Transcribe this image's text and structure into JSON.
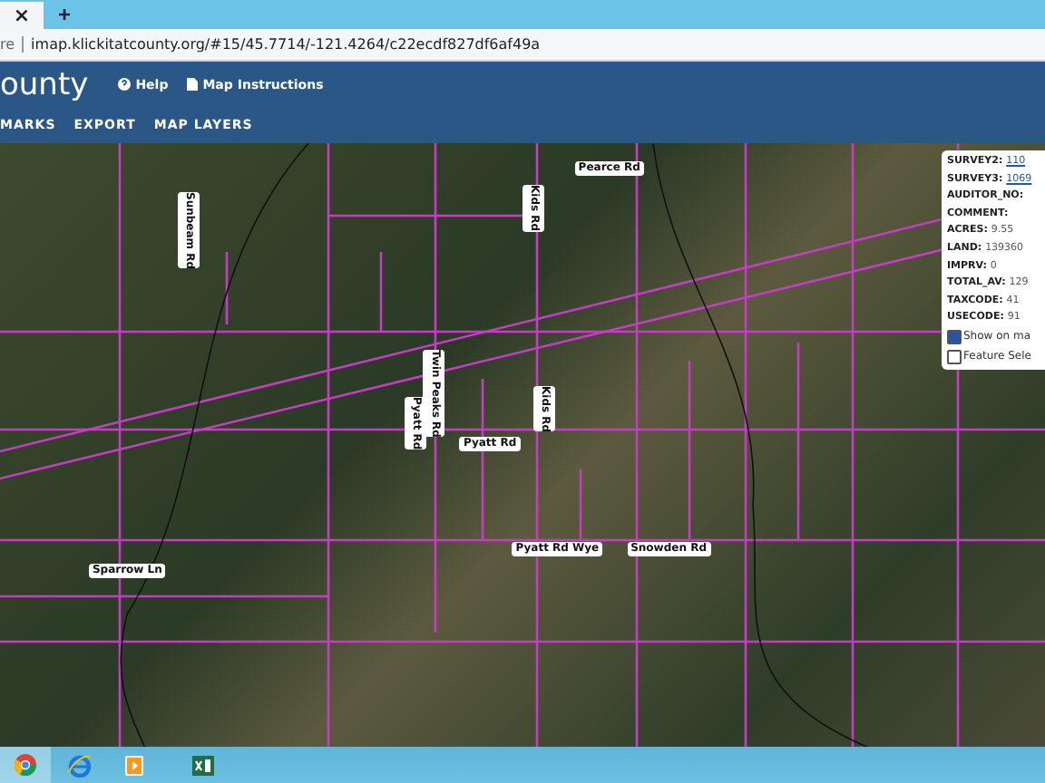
{
  "browser": {
    "tab_close": "×",
    "new_tab": "+",
    "address_prefix": "re",
    "url": "imap.klickitatcounty.org/#15/45.7714/-121.4264/c22ecdf827df6af49a"
  },
  "header": {
    "title": "ounty",
    "links": [
      {
        "label": "Help",
        "kind": "help"
      },
      {
        "label": "Map Instructions",
        "kind": "doc"
      }
    ]
  },
  "nav": [
    "MARKS",
    "EXPORT",
    "MAP LAYERS"
  ],
  "map": {
    "road_labels": [
      {
        "text": "Sunbeam Rd",
        "vertical": true
      },
      {
        "text": "Pearce Rd",
        "vertical": false
      },
      {
        "text": "Kids Rd",
        "vertical": true
      },
      {
        "text": "Twin Peaks Rd",
        "vertical": true
      },
      {
        "text": "Pyatt Rd",
        "vertical": true
      },
      {
        "text": "Kids Rd",
        "vertical": true
      },
      {
        "text": "Pyatt Rd",
        "vertical": false
      },
      {
        "text": "Pyatt Rd Wye",
        "vertical": false
      },
      {
        "text": "Snowden Rd",
        "vertical": false
      },
      {
        "text": "Sparrow Ln",
        "vertical": false
      }
    ],
    "popup": {
      "fields": [
        {
          "label": "SURVEY2:",
          "value": "110",
          "kind": "link"
        },
        {
          "label": "SURVEY3:",
          "value": "1069",
          "kind": "link"
        },
        {
          "label": "AUDITOR_NO:",
          "kind": "text"
        },
        {
          "label": "COMMENT:",
          "kind": "text"
        },
        {
          "label": "ACRES:",
          "value": "9.55",
          "kind": "text"
        },
        {
          "label": "LAND:",
          "value": "139360",
          "kind": "text"
        },
        {
          "label": "IMPRV:",
          "value": "0",
          "kind": "text"
        },
        {
          "label": "TOTAL_AV:",
          "value": "129",
          "kind": "text"
        },
        {
          "label": "TAXCODE:",
          "value": "41",
          "kind": "text"
        },
        {
          "label": "USECODE:",
          "value": "91",
          "kind": "text"
        }
      ],
      "options": [
        {
          "label": "Show on ma",
          "checked": true
        },
        {
          "label": "Feature Sele",
          "checked": false
        }
      ]
    }
  },
  "taskbar": [
    {
      "kind": "chrome",
      "selected": true
    },
    {
      "kind": "ie",
      "selected": false
    },
    {
      "kind": "media",
      "selected": false
    },
    {
      "kind": "excel",
      "selected": false
    }
  ]
}
